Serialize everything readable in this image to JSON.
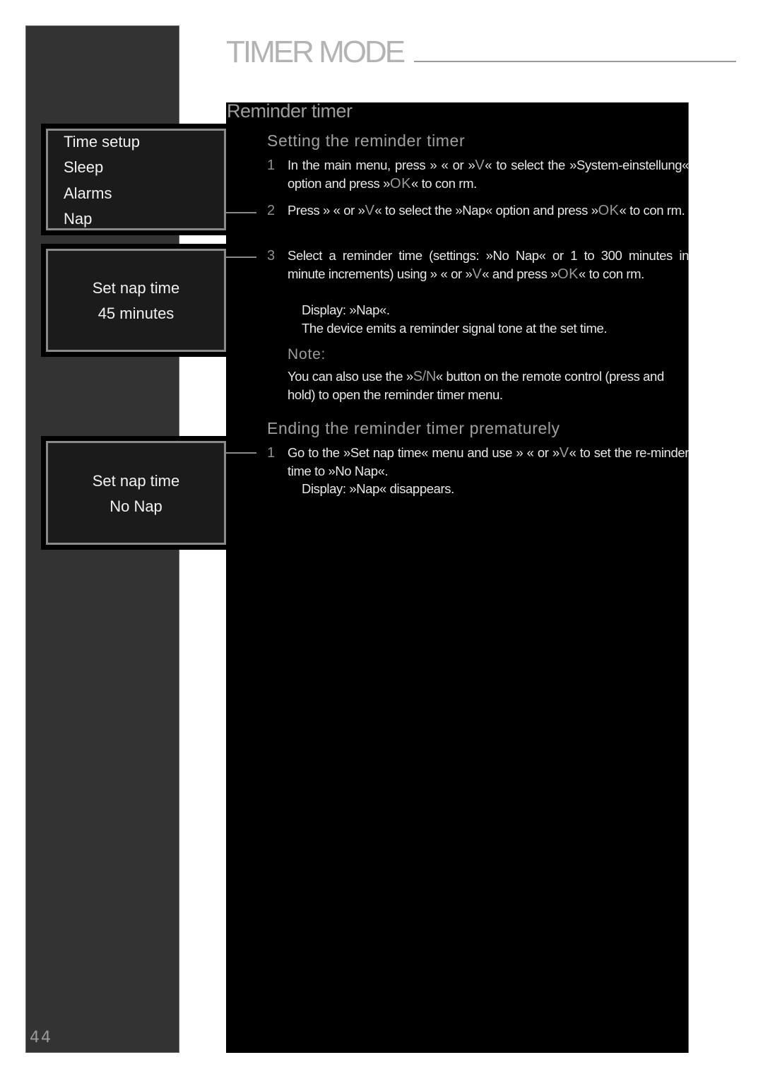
{
  "page": {
    "title": "TIMER MODE",
    "page_number": "44"
  },
  "section": {
    "title": "Reminder timer",
    "setting": {
      "heading": "Setting the reminder timer",
      "steps": [
        {
          "num": "1",
          "parts": [
            "In the main menu, press »",
            " « or »",
            "V",
            "« to select the »System-einstellung« option and press »",
            "OK",
            "« to con  rm."
          ]
        },
        {
          "num": "2",
          "parts": [
            "Press »",
            "  « or »",
            "V",
            "« to select the »Nap« option and press »",
            "OK",
            "« to con  rm."
          ]
        },
        {
          "num": "3",
          "parts": [
            "Select a reminder time (settings: »No Nap« or 1 to 300 minutes in minute increments) using »",
            "  « or »",
            "V",
            "« and press »",
            "OK",
            "« to con  rm."
          ],
          "results": [
            "Display: »Nap«.",
            "The device emits a reminder signal tone at the set time."
          ]
        }
      ]
    },
    "note": {
      "label": "Note:",
      "parts": [
        "You can also use the »",
        "S/N",
        "« button on the remote control (press and hold) to open the reminder timer menu."
      ]
    },
    "ending": {
      "heading": "Ending the reminder timer prematurely",
      "steps": [
        {
          "num": "1",
          "parts": [
            "Go to the »Set nap time« menu and use »",
            "  « or »",
            "V",
            "« to set the re-minder time to »No Nap«."
          ],
          "results": [
            "Display: »Nap« disappears."
          ]
        }
      ]
    }
  },
  "screens": {
    "menu": {
      "items": [
        "Time setup",
        "Sleep",
        "Alarms",
        "Nap"
      ]
    },
    "nap_set": {
      "title": "Set nap time",
      "value": "45 minutes"
    },
    "nap_off": {
      "title": "Set nap time",
      "value": "No Nap"
    }
  }
}
